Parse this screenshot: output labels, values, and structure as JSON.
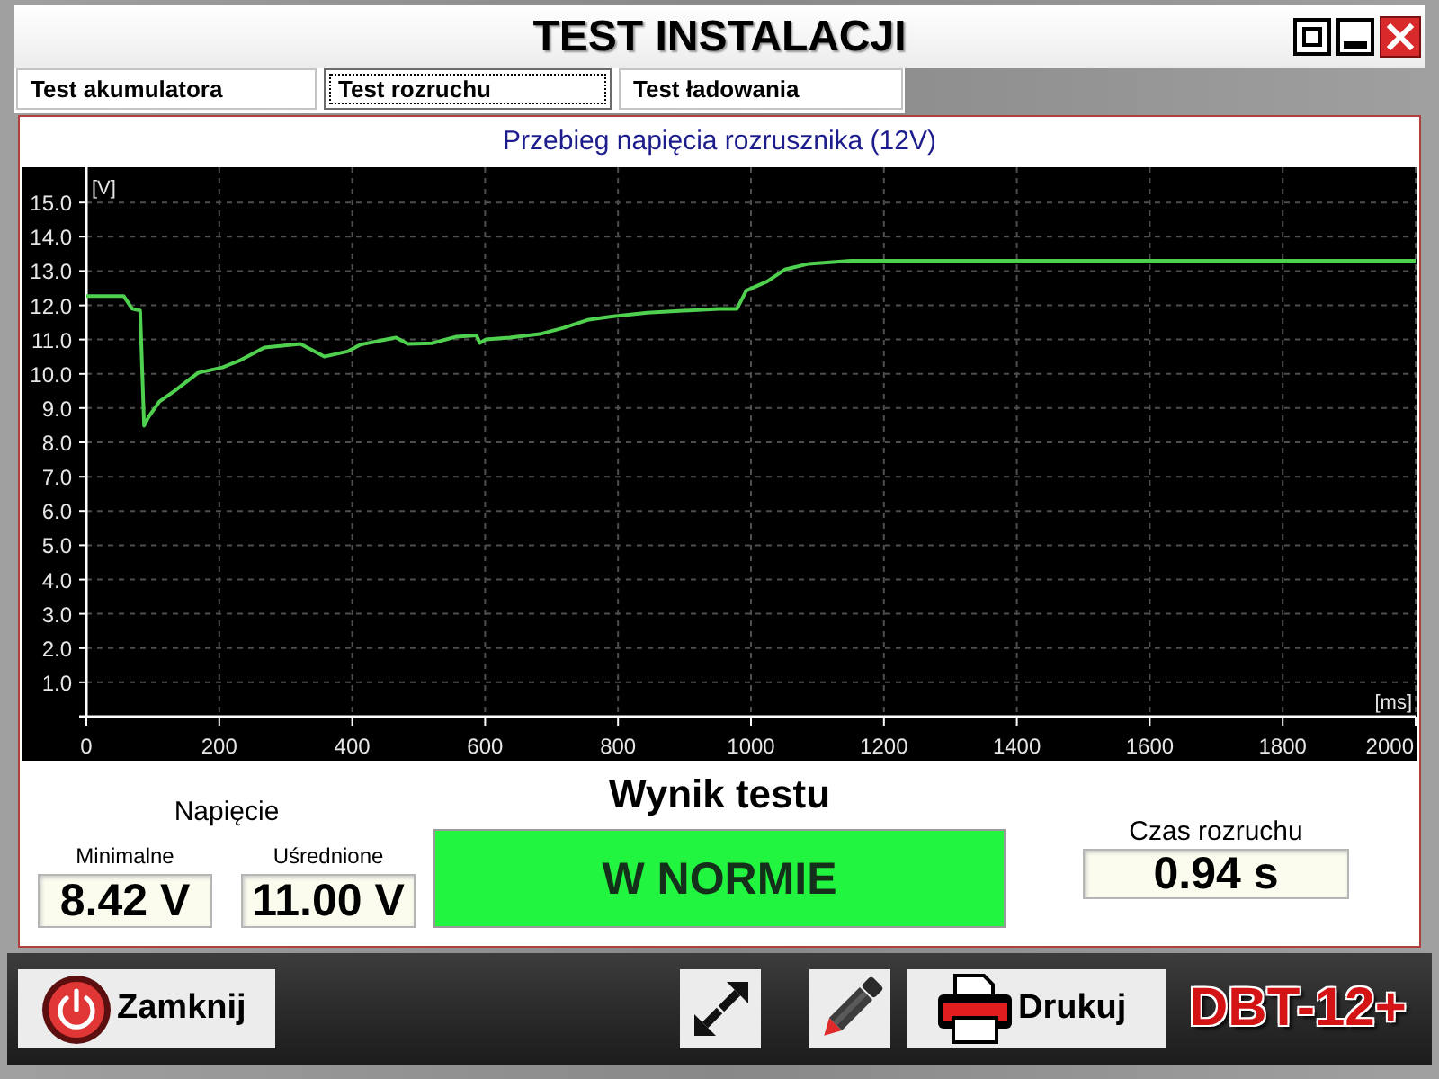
{
  "window": {
    "title": "TEST INSTALACJI"
  },
  "window_controls": [
    {
      "kind": "maximize"
    },
    {
      "kind": "minimize"
    },
    {
      "kind": "close"
    }
  ],
  "tabs": [
    {
      "label": "Test akumulatora",
      "selected": false
    },
    {
      "label": "Test rozruchu",
      "selected": true
    },
    {
      "label": "Test ładowania",
      "selected": false
    }
  ],
  "chart": {
    "chart_data": {
      "type": "line",
      "title": "Przebieg napięcia rozrusznika (12V)",
      "xlabel": "[ms]",
      "ylabel": "[V]",
      "grid": true,
      "x": [
        0,
        56,
        69,
        81,
        87,
        94,
        110,
        132,
        168,
        205,
        232,
        268,
        322,
        358,
        394,
        412,
        448,
        466,
        484,
        520,
        556,
        587,
        592,
        601,
        637,
        682,
        718,
        754,
        790,
        844,
        952,
        979,
        993,
        1024,
        1051,
        1087,
        1150,
        1300,
        1500,
        1700,
        1900,
        2000
      ],
      "values": [
        12.27,
        12.27,
        11.9,
        11.85,
        8.49,
        8.75,
        9.19,
        9.49,
        10.03,
        10.19,
        10.4,
        10.77,
        10.87,
        10.5,
        10.66,
        10.85,
        10.99,
        11.06,
        10.87,
        10.89,
        11.08,
        11.12,
        10.9,
        11.0,
        11.06,
        11.16,
        11.34,
        11.57,
        11.67,
        11.78,
        11.9,
        11.9,
        12.43,
        12.69,
        13.04,
        13.21,
        13.3,
        13.3,
        13.3,
        13.3,
        13.3,
        13.3
      ],
      "xlim": [
        0,
        2000
      ],
      "ylim": [
        0,
        16
      ],
      "xticks": [
        0,
        200,
        400,
        600,
        800,
        1000,
        1200,
        1400,
        1600,
        1800,
        2000
      ],
      "yticks": [
        {
          "value": 1,
          "label": "1.0"
        },
        {
          "value": 2,
          "label": "2.0"
        },
        {
          "value": 3,
          "label": "3.0"
        },
        {
          "value": 4,
          "label": "4.0"
        },
        {
          "value": 5,
          "label": "5.0"
        },
        {
          "value": 6,
          "label": "6.0"
        },
        {
          "value": 7,
          "label": "7.0"
        },
        {
          "value": 8,
          "label": "8.0"
        },
        {
          "value": 9,
          "label": "9.0"
        },
        {
          "value": 10,
          "label": "10.0"
        },
        {
          "value": 11,
          "label": "11.0"
        },
        {
          "value": 12,
          "label": "12.0"
        },
        {
          "value": 13,
          "label": "13.0"
        },
        {
          "value": 14,
          "label": "14.0"
        },
        {
          "value": 15,
          "label": "15.0"
        }
      ]
    }
  },
  "voltage": {
    "title": "Napięcie",
    "readings": [
      {
        "label": "Minimalne",
        "value": "8.42 V"
      },
      {
        "label": "Uśrednione",
        "value": "11.00 V"
      }
    ]
  },
  "result": {
    "title": "Wynik testu",
    "value": "W NORMIE",
    "passed": true
  },
  "crank_time": {
    "label": "Czas rozruchu",
    "value": "0.94 s"
  },
  "toolbar": [
    {
      "kind": "close",
      "label": "Zamknij"
    },
    {
      "kind": "expand"
    },
    {
      "kind": "edit"
    },
    {
      "kind": "print",
      "label": "Drukuj"
    }
  ],
  "logo": "DBT-12+"
}
